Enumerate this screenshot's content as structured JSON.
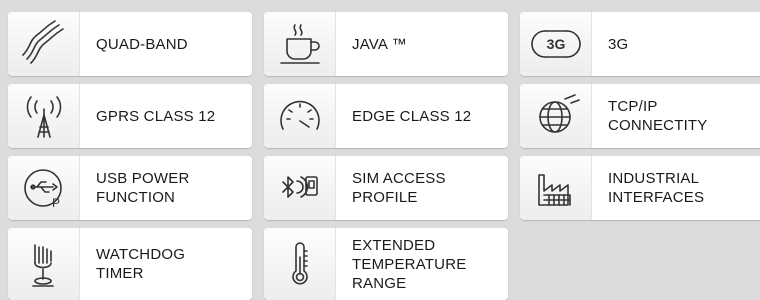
{
  "features": [
    {
      "label": "QUAD-BAND",
      "icon": "waves-icon"
    },
    {
      "label": "JAVA ™",
      "icon": "coffee-cup-icon"
    },
    {
      "label": "3G",
      "icon": "3g-icon",
      "icon_text": "3G"
    },
    {
      "label": "GPRS CLASS 12",
      "icon": "antenna-icon"
    },
    {
      "label": "EDGE CLASS 12",
      "icon": "speedometer-icon"
    },
    {
      "label": "TCP/IP\nCONNECTITY",
      "icon": "globe-icon"
    },
    {
      "label": "USB POWER\nFUNCTION",
      "icon": "usb-power-icon",
      "icon_text": "P"
    },
    {
      "label": "SIM ACCESS\nPROFILE",
      "icon": "bluetooth-sim-icon"
    },
    {
      "label": "INDUSTRIAL\nINTERFACES",
      "icon": "factory-icon"
    },
    {
      "label": "WATCHDOG\nTIMER",
      "icon": "pointing-hand-icon"
    },
    {
      "label": "EXTENDED\nTEMPERATURE\nRANGE",
      "icon": "thermometer-icon"
    }
  ],
  "colors": {
    "background": "#dcdcdc",
    "tile": "#ffffff",
    "text": "#1a1a1a",
    "icon": "#333333"
  }
}
